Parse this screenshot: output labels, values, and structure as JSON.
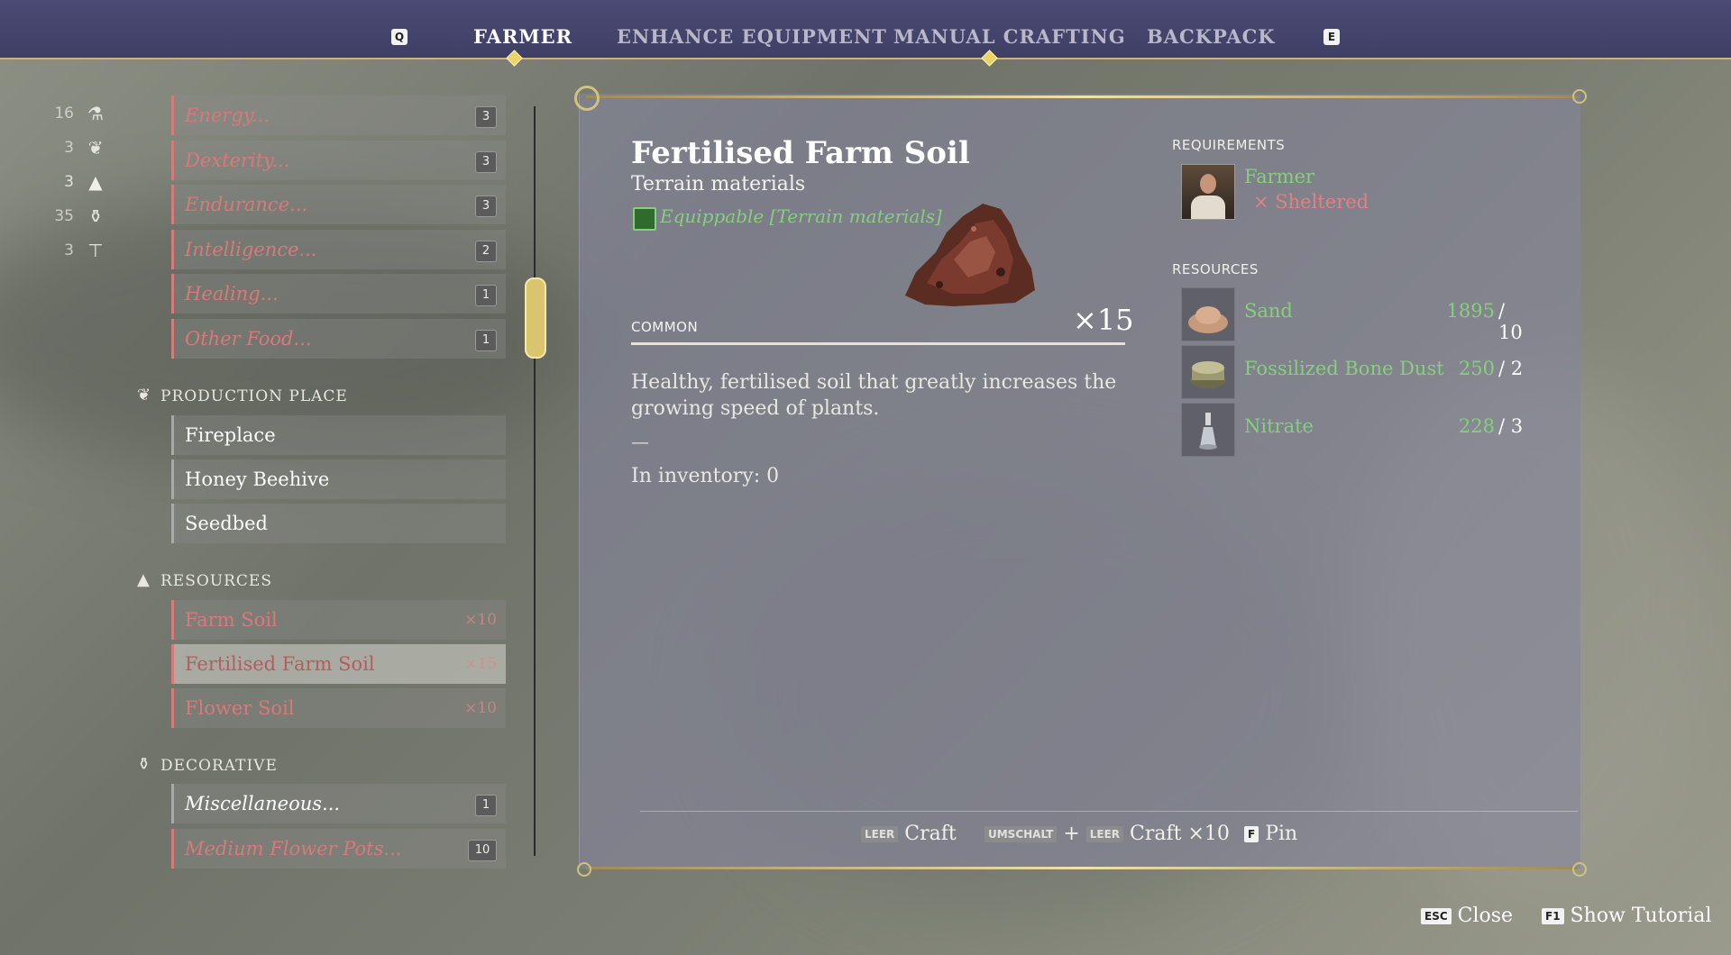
{
  "top_nav": {
    "prev_key": "Q",
    "next_key": "E",
    "tabs": [
      {
        "label": "FARMER",
        "active": true
      },
      {
        "label": "ENHANCE EQUIPMENT",
        "active": false
      },
      {
        "label": "MANUAL CRAFTING",
        "active": false
      },
      {
        "label": "BACKPACK",
        "active": false
      }
    ]
  },
  "sidebar": {
    "category_counts": [
      {
        "count": "16",
        "icon": "potion-icon"
      },
      {
        "count": "3",
        "icon": "plant-icon"
      },
      {
        "count": "3",
        "icon": "ingots-icon",
        "active": true
      },
      {
        "count": "35",
        "icon": "vase-icon"
      },
      {
        "count": "3",
        "icon": "anvil-icon"
      }
    ],
    "food_items": [
      {
        "label": "Energy...",
        "count": "3"
      },
      {
        "label": "Dexterity...",
        "count": "3"
      },
      {
        "label": "Endurance...",
        "count": "3"
      },
      {
        "label": "Intelligence...",
        "count": "2"
      },
      {
        "label": "Healing...",
        "count": "1"
      },
      {
        "label": "Other Food...",
        "count": "1"
      }
    ],
    "production_place": {
      "heading": "PRODUCTION PLACE",
      "items": [
        "Fireplace",
        "Honey Beehive",
        "Seedbed"
      ]
    },
    "resources": {
      "heading": "RESOURCES",
      "items": [
        {
          "label": "Farm Soil",
          "mult": "×10"
        },
        {
          "label": "Fertilised Farm Soil",
          "mult": "×15",
          "selected": true
        },
        {
          "label": "Flower Soil",
          "mult": "×10"
        }
      ]
    },
    "decorative": {
      "heading": "DECORATIVE",
      "items": [
        {
          "label": "Miscellaneous...",
          "count": "1"
        },
        {
          "label": "Medium Flower Pots...",
          "count": "10"
        }
      ]
    }
  },
  "detail": {
    "title": "Fertilised Farm Soil",
    "subtitle": "Terrain materials",
    "equippable": "Equippable [Terrain materials]",
    "rarity": "COMMON",
    "quantity": "×15",
    "description": "Healthy, fertilised soil that greatly increases the growing speed of plants.",
    "dash": "—",
    "inventory": "In inventory: 0"
  },
  "requirements": {
    "heading": "REQUIREMENTS",
    "profession": "Farmer",
    "missing": "× Sheltered"
  },
  "resources_needed": {
    "heading": "RESOURCES",
    "items": [
      {
        "name": "Sand",
        "have": "1895",
        "need": "/ 10",
        "icon": "sand-icon"
      },
      {
        "name": "Fossilized Bone Dust",
        "have": "250",
        "need": "/ 2",
        "icon": "bone-dust-icon"
      },
      {
        "name": "Nitrate",
        "have": "228",
        "need": "/ 3",
        "icon": "nitrate-icon"
      }
    ]
  },
  "actions": {
    "craft_key": "LEER",
    "craft_label": "Craft",
    "shift_key": "UMSCHALT",
    "plus": "+",
    "craft10_key": "LEER",
    "craft10_label": "Craft ×10",
    "pin_key": "F",
    "pin_label": "Pin"
  },
  "corner": {
    "close_key": "ESC",
    "close_label": "Close",
    "tutorial_key": "F1",
    "tutorial_label": "Show Tutorial"
  },
  "colors": {
    "accent_gold": "#d8c56d",
    "green": "#86cf7c",
    "red": "#e48080",
    "topbar": "#44446c"
  }
}
